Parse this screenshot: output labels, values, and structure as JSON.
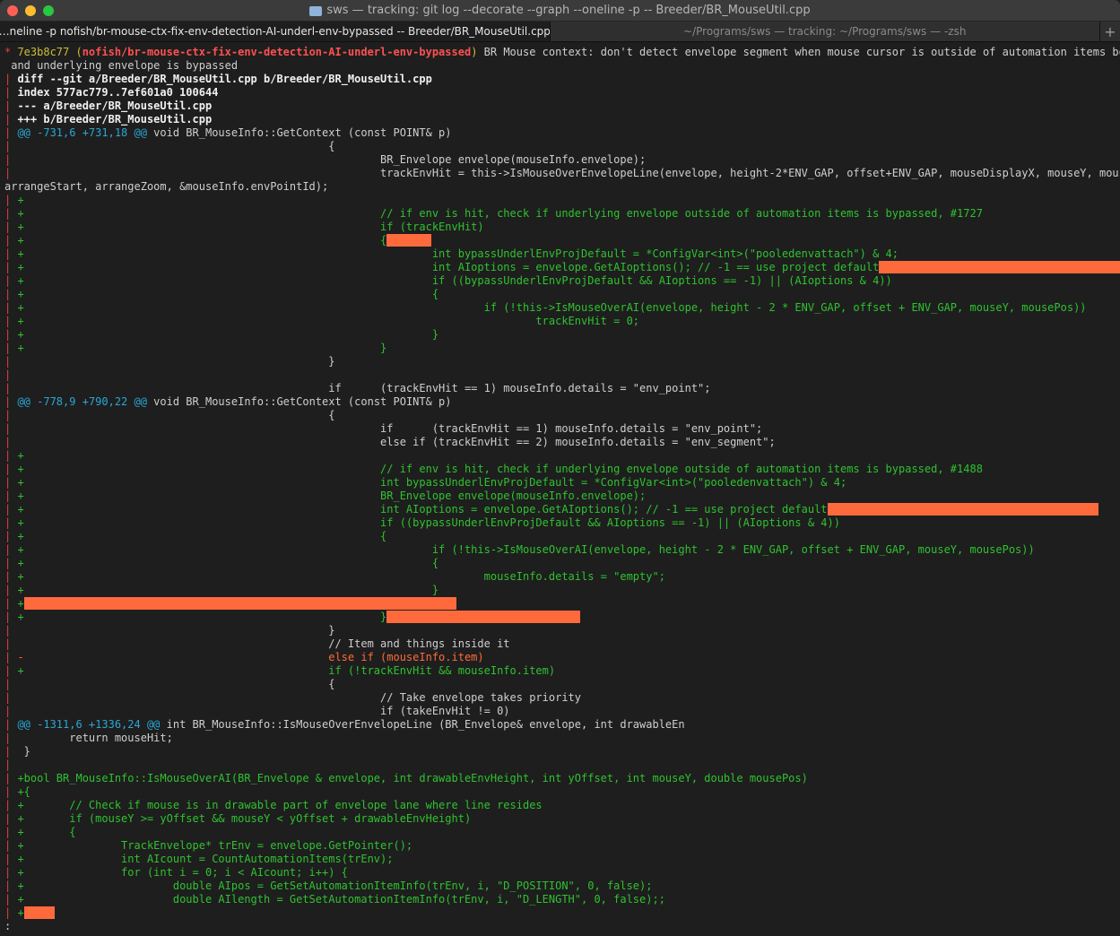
{
  "window": {
    "title": "sws — tracking: git log --decorate --graph --oneline -p  -- Breeder/BR_MouseUtil.cpp"
  },
  "tabs": [
    {
      "label": "…neline -p nofish/br-mouse-ctx-fix-env-detection-AI-underl-env-bypassed -- Breeder/BR_MouseUtil.cpp",
      "active": true
    },
    {
      "label": "~/Programs/sws — tracking: ~/Programs/sws — -zsh",
      "active": false
    }
  ],
  "tab_add_label": "+",
  "colors": {
    "background": "#1e1e1e",
    "added": "#2fc22f",
    "removed": "#ff6b35",
    "hunk": "#2aa7d6",
    "graph": "#e04040",
    "hash": "#cdbd3a",
    "branch": "#ff5050",
    "redaction": "#ff6a3d"
  },
  "commit": {
    "graph": "* ",
    "hash": "7e3b8c77",
    "ref_open": " (",
    "branch": "nofish/br-mouse-ctx-fix-env-detection-AI-underl-env-bypassed",
    "ref_close": ")",
    "message": " BR Mouse context: don't detect envelope segment when mouse cursor is outside of automation items bounds",
    "message_cont": " and underlying envelope is bypassed"
  },
  "lines": [
    {
      "t": "hdr",
      "text": "diff --git a/Breeder/BR_MouseUtil.cpp b/Breeder/BR_MouseUtil.cpp"
    },
    {
      "t": "hdr",
      "text": "index 577ac779..7ef601a0 100644"
    },
    {
      "t": "hdr",
      "text": "--- a/Breeder/BR_MouseUtil.cpp"
    },
    {
      "t": "hdr",
      "text": "+++ b/Breeder/BR_MouseUtil.cpp"
    },
    {
      "t": "hunk",
      "text": "@@ -731,6 +731,18 @@",
      "rest": " void BR_MouseInfo::GetContext (const POINT& p)"
    },
    {
      "t": "ctx",
      "text": "                                                {"
    },
    {
      "t": "ctx",
      "text": "                                                        BR_Envelope envelope(mouseInfo.envelope);"
    },
    {
      "t": "ctx",
      "text": "                                                        trackEnvHit = this->IsMouseOverEnvelopeLine(envelope, height-2*ENV_GAP, offset+ENV_GAP, mouseDisplayX, mouseY, mousePos,"
    },
    {
      "t": "wrap",
      "text": "arrangeStart, arrangeZoom, &mouseInfo.envPointId);"
    },
    {
      "t": "add",
      "text": "+"
    },
    {
      "t": "add",
      "text": "+                                                       // if env is hit, check if underlying envelope outside of automation items is bypassed, #1727"
    },
    {
      "t": "add",
      "text": "+                                                       if (trackEnvHit)"
    },
    {
      "t": "add",
      "text": "+                                                       {",
      "redact": 50
    },
    {
      "t": "add",
      "text": "+                                                               int bypassUnderlEnvProjDefault = *ConfigVar<int>(\"pooledenvattach\") & 4;"
    },
    {
      "t": "add",
      "text": "+                                                               int AIoptions = envelope.GetAIoptions(); // -1 == use project default",
      "redact": 302
    },
    {
      "t": "add",
      "text": "+                                                               if ((bypassUnderlEnvProjDefault && AIoptions == -1) || (AIoptions & 4))"
    },
    {
      "t": "add",
      "text": "+                                                               {"
    },
    {
      "t": "add",
      "text": "+                                                                       if (!this->IsMouseOverAI(envelope, height - 2 * ENV_GAP, offset + ENV_GAP, mouseY, mousePos))"
    },
    {
      "t": "add",
      "text": "+                                                                               trackEnvHit = 0;"
    },
    {
      "t": "add",
      "text": "+                                                               }"
    },
    {
      "t": "add",
      "text": "+                                                       }"
    },
    {
      "t": "ctx",
      "text": "                                                }"
    },
    {
      "t": "ctx",
      "text": ""
    },
    {
      "t": "ctx",
      "text": "                                                if      (trackEnvHit == 1) mouseInfo.details = \"env_point\";"
    },
    {
      "t": "hunk",
      "text": "@@ -778,9 +790,22 @@",
      "rest": " void BR_MouseInfo::GetContext (const POINT& p)"
    },
    {
      "t": "ctx",
      "text": "                                                {"
    },
    {
      "t": "ctx",
      "text": "                                                        if      (trackEnvHit == 1) mouseInfo.details = \"env_point\";"
    },
    {
      "t": "ctx",
      "text": "                                                        else if (trackEnvHit == 2) mouseInfo.details = \"env_segment\";"
    },
    {
      "t": "add",
      "text": "+"
    },
    {
      "t": "add",
      "text": "+                                                       // if env is hit, check if underlying envelope outside of automation items is bypassed, #1488"
    },
    {
      "t": "add",
      "text": "+                                                       int bypassUnderlEnvProjDefault = *ConfigVar<int>(\"pooledenvattach\") & 4;"
    },
    {
      "t": "add",
      "text": "+                                                       BR_Envelope envelope(mouseInfo.envelope);"
    },
    {
      "t": "add",
      "text": "+                                                       int AIoptions = envelope.GetAIoptions(); // -1 == use project default",
      "redact": 302
    },
    {
      "t": "add",
      "text": "+                                                       if ((bypassUnderlEnvProjDefault && AIoptions == -1) || (AIoptions & 4))"
    },
    {
      "t": "add",
      "text": "+                                                       {"
    },
    {
      "t": "add",
      "text": "+                                                               if (!this->IsMouseOverAI(envelope, height - 2 * ENV_GAP, offset + ENV_GAP, mouseY, mousePos))"
    },
    {
      "t": "add",
      "text": "+                                                               {"
    },
    {
      "t": "add",
      "text": "+                                                                       mouseInfo.details = \"empty\";"
    },
    {
      "t": "add",
      "text": "+                                                               }"
    },
    {
      "t": "add",
      "text": "+",
      "redact": 482
    },
    {
      "t": "add",
      "text": "+                                                       }",
      "redact": 216
    },
    {
      "t": "ctx",
      "text": "                                                }"
    },
    {
      "t": "ctx",
      "text": "                                                // Item and things inside it"
    },
    {
      "t": "del",
      "text": "-                                               else if (mouseInfo.item)"
    },
    {
      "t": "add",
      "text": "+                                               if (!trackEnvHit && mouseInfo.item)"
    },
    {
      "t": "ctx",
      "text": "                                                {"
    },
    {
      "t": "ctx",
      "text": "                                                        // Take envelope takes priority"
    },
    {
      "t": "ctx",
      "text": "                                                        if (takeEnvHit != 0)"
    },
    {
      "t": "hunk",
      "text": "@@ -1311,6 +1336,24 @@",
      "rest": " int BR_MouseInfo::IsMouseOverEnvelopeLine (BR_Envelope& envelope, int drawableEn"
    },
    {
      "t": "ctx",
      "text": "        return mouseHit;"
    },
    {
      "t": "ctx",
      "text": " }"
    },
    {
      "t": "ctx",
      "text": ""
    },
    {
      "t": "add",
      "text": "+bool BR_MouseInfo::IsMouseOverAI(BR_Envelope & envelope, int drawableEnvHeight, int yOffset, int mouseY, double mousePos)"
    },
    {
      "t": "add",
      "text": "+{"
    },
    {
      "t": "add",
      "text": "+       // Check if mouse is in drawable part of envelope lane where line resides"
    },
    {
      "t": "add",
      "text": "+       if (mouseY >= yOffset && mouseY < yOffset + drawableEnvHeight)"
    },
    {
      "t": "add",
      "text": "+       {"
    },
    {
      "t": "add",
      "text": "+               TrackEnvelope* trEnv = envelope.GetPointer();"
    },
    {
      "t": "add",
      "text": "+               int AIcount = CountAutomationItems(trEnv);"
    },
    {
      "t": "add",
      "text": "+               for (int i = 0; i < AIcount; i++) {"
    },
    {
      "t": "add",
      "text": "+                       double AIpos = GetSetAutomationItemInfo(trEnv, i, \"D_POSITION\", 0, false);"
    },
    {
      "t": "add",
      "text": "+                       double AIlength = GetSetAutomationItemInfo(trEnv, i, \"D_LENGTH\", 0, false);;"
    },
    {
      "t": "add",
      "text": "+",
      "redact": 34
    }
  ],
  "pager_prompt": ":"
}
